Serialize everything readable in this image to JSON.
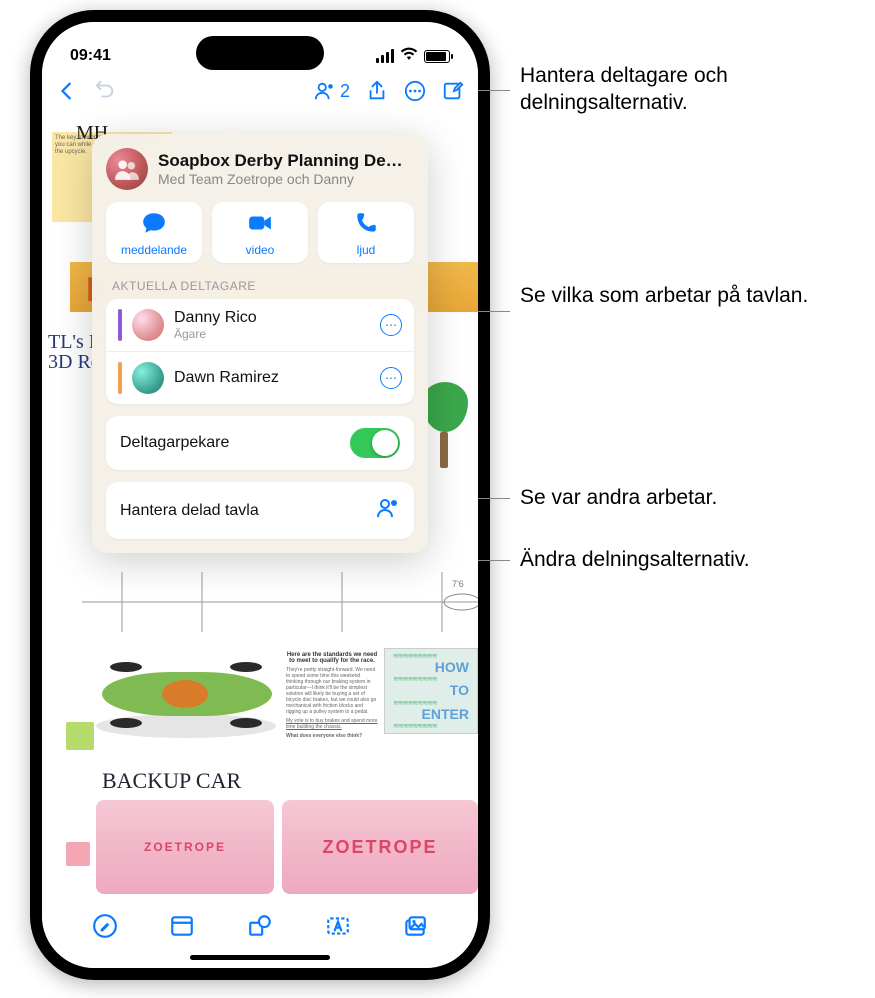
{
  "status": {
    "time": "09:41"
  },
  "toolbar": {
    "collaborators_count": "2"
  },
  "popover": {
    "title": "Soapbox Derby Planning De…",
    "subtitle": "Med Team Zoetrope och Danny",
    "comm": {
      "message": "meddelande",
      "video": "video",
      "audio": "ljud"
    },
    "section_label": "AKTUELLA DELTAGARE",
    "participants": [
      {
        "name": "Danny Rico",
        "role": "Ägare"
      },
      {
        "name": "Dawn Ramirez",
        "role": ""
      }
    ],
    "cursor_toggle_label": "Deltagarpekare",
    "cursor_toggle_on": true,
    "manage_label": "Hantera delad tavla"
  },
  "board": {
    "backup_car_label": "BACKUP CAR",
    "how_to_enter": {
      "l1": "HOW",
      "l2": "TO",
      "l3": "ENTER"
    }
  },
  "callouts": {
    "manage": "Hantera deltagare och delningsalternativ.",
    "seewho": "Se vilka som arbetar på tavlan.",
    "cursors": "Se var andra arbetar.",
    "changeshare": "Ändra delningsalternativ."
  }
}
